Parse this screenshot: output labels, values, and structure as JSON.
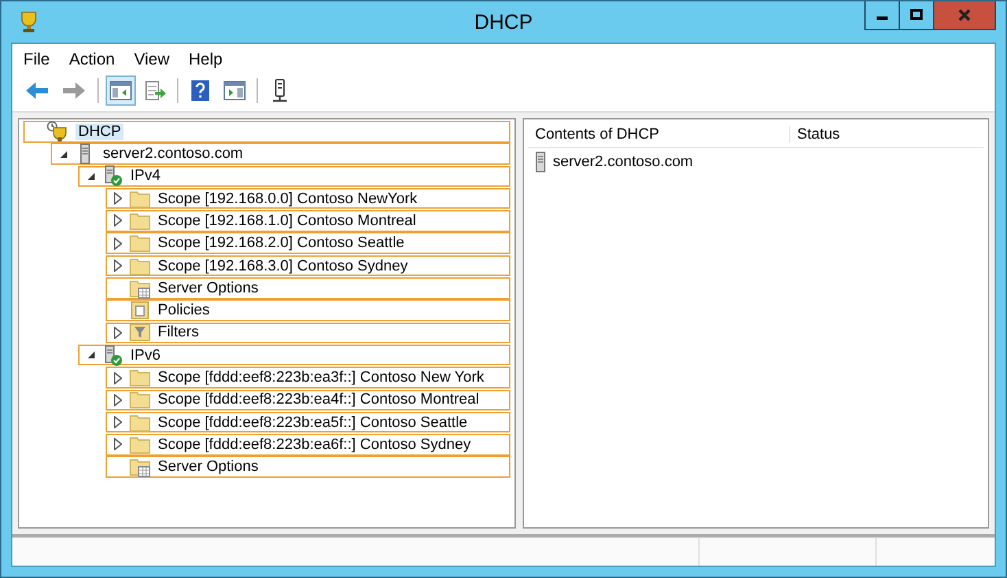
{
  "window": {
    "title": "DHCP"
  },
  "menu": [
    "File",
    "Action",
    "View",
    "Help"
  ],
  "toolbar": [
    {
      "kind": "back",
      "pressed": false
    },
    {
      "kind": "forward",
      "pressed": false
    },
    {
      "kind": "sep"
    },
    {
      "kind": "tree-toggle",
      "pressed": true
    },
    {
      "kind": "export",
      "pressed": false
    },
    {
      "kind": "sep"
    },
    {
      "kind": "help",
      "pressed": false
    },
    {
      "kind": "pane",
      "pressed": false
    },
    {
      "kind": "sep"
    },
    {
      "kind": "connect",
      "pressed": false
    }
  ],
  "tree": [
    {
      "label": "DHCP",
      "kind": "root",
      "selected": true,
      "children": [
        {
          "label": "server2.contoso.com",
          "kind": "server",
          "expanded": true,
          "selected": false,
          "children": [
            {
              "label": "IPv4",
              "kind": "protocol",
              "expanded": true,
              "selected": false,
              "children": [
                {
                  "label": "Scope [192.168.0.0] Contoso NewYork",
                  "kind": "scope",
                  "expanded": false,
                  "selected": false
                },
                {
                  "label": "Scope [192.168.1.0] Contoso Montreal",
                  "kind": "scope",
                  "expanded": false,
                  "selected": false
                },
                {
                  "label": "Scope [192.168.2.0] Contoso Seattle",
                  "kind": "scope",
                  "expanded": false,
                  "selected": false
                },
                {
                  "label": "Scope [192.168.3.0] Contoso Sydney",
                  "kind": "scope",
                  "expanded": false,
                  "selected": false
                },
                {
                  "label": "Server Options",
                  "kind": "options",
                  "selected": false
                },
                {
                  "label": "Policies",
                  "kind": "policies",
                  "selected": false
                },
                {
                  "label": "Filters",
                  "kind": "filters",
                  "expanded": false,
                  "selected": false
                }
              ]
            },
            {
              "label": "IPv6",
              "kind": "protocol",
              "expanded": true,
              "selected": false,
              "children": [
                {
                  "label": "Scope [fddd:eef8:223b:ea3f::] Contoso New York",
                  "kind": "scope",
                  "expanded": false,
                  "selected": false
                },
                {
                  "label": "Scope [fddd:eef8:223b:ea4f::] Contoso Montreal",
                  "kind": "scope",
                  "expanded": false,
                  "selected": false
                },
                {
                  "label": "Scope [fddd:eef8:223b:ea5f::] Contoso Seattle",
                  "kind": "scope",
                  "expanded": false,
                  "selected": false
                },
                {
                  "label": "Scope [fddd:eef8:223b:ea6f::] Contoso Sydney",
                  "kind": "scope",
                  "expanded": false,
                  "selected": false
                },
                {
                  "label": "Server Options",
                  "kind": "options",
                  "selected": false
                }
              ]
            }
          ]
        }
      ]
    }
  ],
  "list": {
    "columns": [
      "Contents of DHCP",
      "Status"
    ],
    "rows": [
      {
        "name": "server2.contoso.com",
        "kind": "server"
      }
    ]
  }
}
